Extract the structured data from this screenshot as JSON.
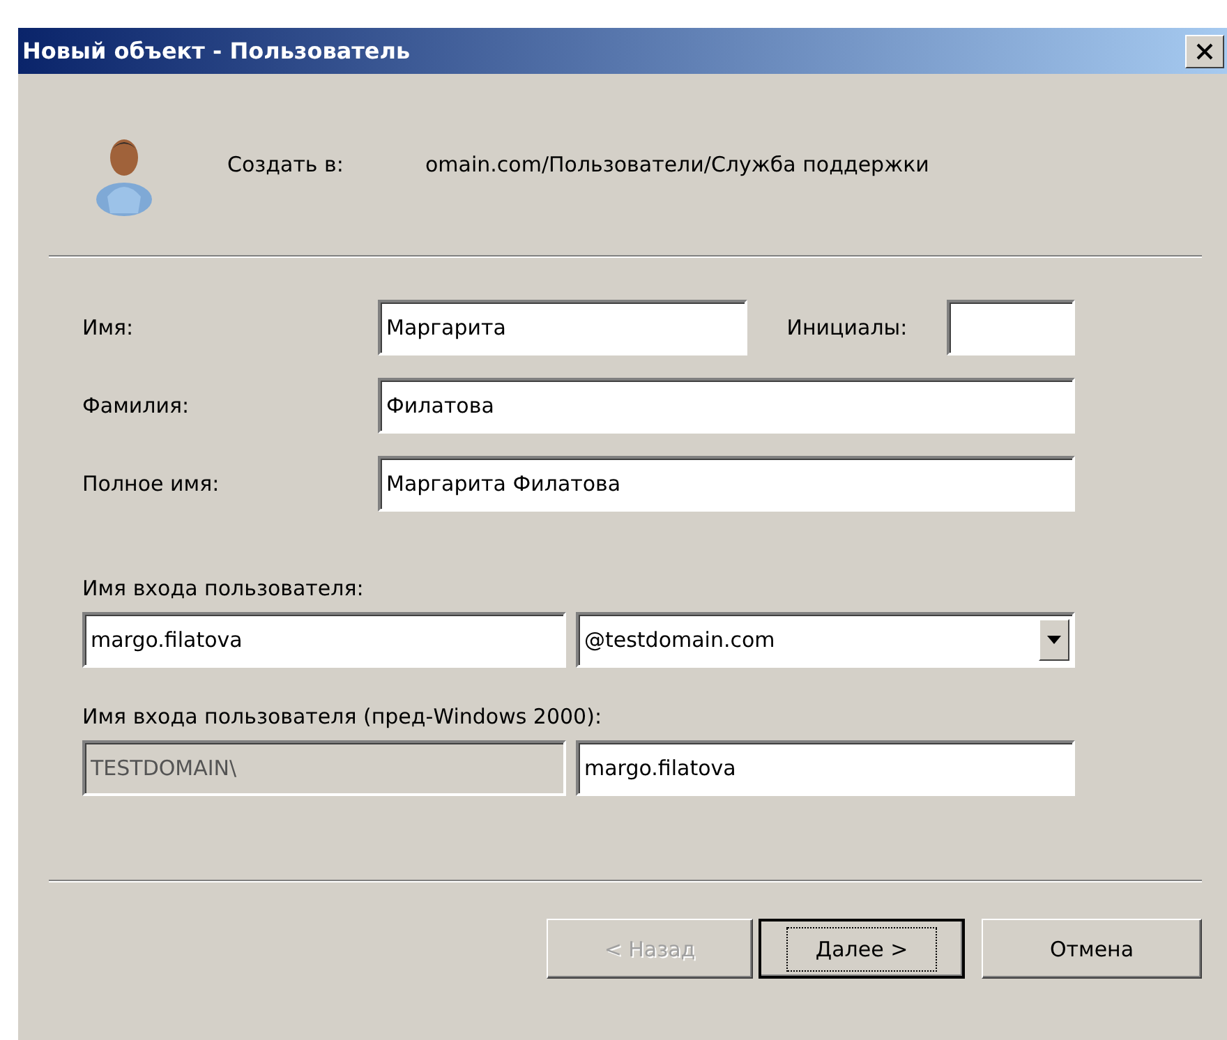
{
  "window": {
    "title": "Новый объект - Пользователь"
  },
  "header": {
    "label": "Создать в:",
    "path": "omain.com/Пользователи/Служба поддержки"
  },
  "first_name": {
    "label": "Имя:",
    "value": "Маргарита"
  },
  "initials": {
    "label": "Инициалы:"
  },
  "last_name": {
    "label": "Фамилия:",
    "value": "Филатова"
  },
  "full_name": {
    "label": "Полное имя:",
    "value": "Маргарита Филатова"
  },
  "logon": {
    "label": "Имя входа пользователя:",
    "value": "margo.filatova",
    "domain": "@testdomain.com"
  },
  "pre2000": {
    "label": "Имя входа пользователя (пред-Windows 2000):",
    "prefix": "TESTDOMAIN\\",
    "prefix_disabled": true,
    "value": "margo.filatova"
  },
  "buttons": [
    {
      "label": "< Назад",
      "disabled": true,
      "default": false
    },
    {
      "label": "Далее >",
      "disabled": false,
      "default": true
    },
    {
      "label": "Отмена",
      "disabled": false,
      "default": false
    }
  ]
}
